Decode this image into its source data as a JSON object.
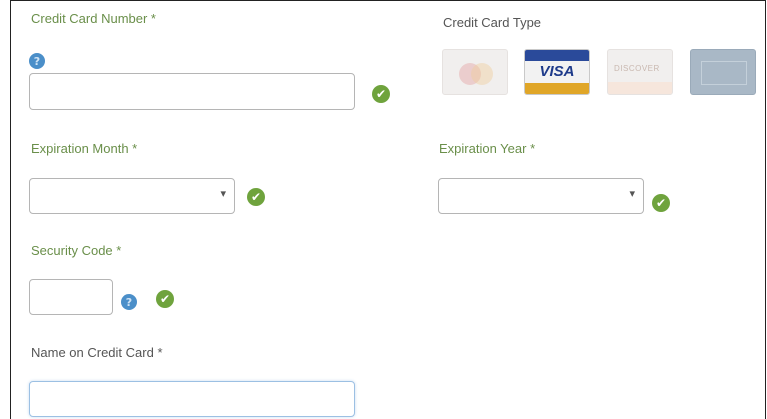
{
  "form": {
    "card_number": {
      "label": "Credit Card Number *",
      "value": "",
      "placeholder": ""
    },
    "card_type": {
      "label": "Credit Card Type",
      "cards": [
        "mastercard",
        "visa",
        "discover",
        "american-express"
      ],
      "visa_text": "VISA",
      "discover_text": "DISCOVER"
    },
    "expiration_month": {
      "label": "Expiration Month *",
      "selected": "",
      "caret": "▾"
    },
    "expiration_year": {
      "label": "Expiration Year *",
      "selected": "",
      "caret": "▾"
    },
    "security_code": {
      "label": "Security Code *",
      "value": ""
    },
    "name_on_card": {
      "label": "Name on Credit Card *",
      "value": ""
    }
  },
  "icons": {
    "help": "help-icon",
    "valid": "checkmark-icon",
    "check_glyph": "✔",
    "help_glyph": "?"
  },
  "colors": {
    "label_green": "#6a8f4a",
    "check_green": "#6fa33d",
    "help_blue": "#4b8fc9",
    "focus_border": "#9cc0e3"
  }
}
